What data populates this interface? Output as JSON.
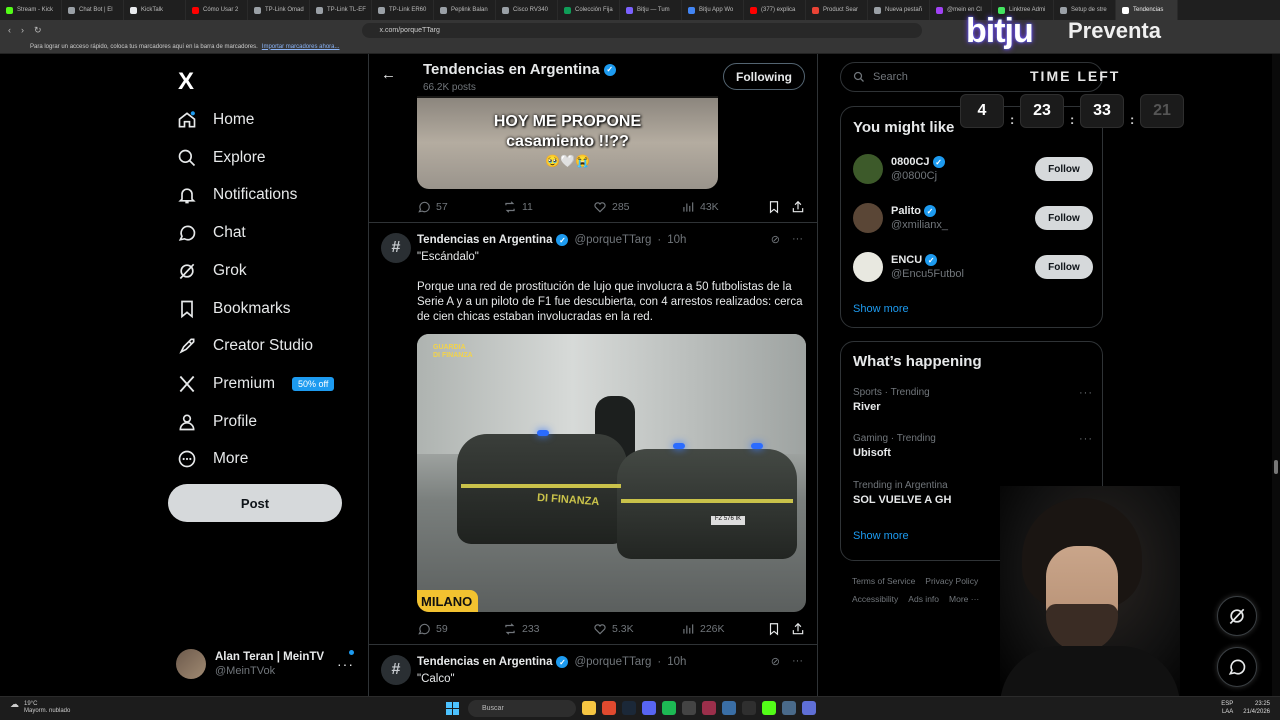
{
  "browser": {
    "tabs": [
      {
        "title": "Stream - Kick",
        "color": "#53fc18"
      },
      {
        "title": "Chat Bot | El",
        "color": "#9aa0a6"
      },
      {
        "title": "KickTalk",
        "color": "#e8eaed"
      },
      {
        "title": "Cómo Usar 2",
        "color": "#ff0000"
      },
      {
        "title": "TP-Link Omad",
        "color": "#9aa0a6"
      },
      {
        "title": "TP-Link TL-EF",
        "color": "#9aa0a6"
      },
      {
        "title": "TP-Link ER60",
        "color": "#9aa0a6"
      },
      {
        "title": "Peplink Balan",
        "color": "#9aa0a6"
      },
      {
        "title": "Cisco RV340",
        "color": "#9aa0a6"
      },
      {
        "title": "Colección Fija",
        "color": "#0f9d58"
      },
      {
        "title": "Bitju — Tum",
        "color": "#7b61ff"
      },
      {
        "title": "Bitju App Wo",
        "color": "#4285f4"
      },
      {
        "title": "(377) explica",
        "color": "#ff0000"
      },
      {
        "title": "Product Sear",
        "color": "#ea4335"
      },
      {
        "title": "Nueva pestañ",
        "color": "#9aa0a6"
      },
      {
        "title": "@mein en Cl",
        "color": "#a142f4"
      },
      {
        "title": "Linktree Admi",
        "color": "#43e660"
      },
      {
        "title": "Setup de stre",
        "color": "#9aa0a6"
      },
      {
        "title": "Tendencias",
        "color": "#ffffff"
      }
    ],
    "url": "x.com/porqueTTarg",
    "bookmarks_hint": "Para lograr un acceso rápido, coloca tus marcadores aquí en la barra de marcadores.",
    "bookmarks_link": "Importar marcadores ahora..."
  },
  "sidebar": {
    "logo": "X",
    "items": [
      {
        "label": "Home",
        "icon": "home-icon"
      },
      {
        "label": "Explore",
        "icon": "search-icon"
      },
      {
        "label": "Notifications",
        "icon": "bell-icon"
      },
      {
        "label": "Chat",
        "icon": "chat-icon"
      },
      {
        "label": "Grok",
        "icon": "grok-icon"
      },
      {
        "label": "Bookmarks",
        "icon": "bookmark-icon"
      },
      {
        "label": "Creator Studio",
        "icon": "rocket-icon"
      },
      {
        "label": "Premium",
        "icon": "x-icon",
        "badge": "50% off"
      },
      {
        "label": "Profile",
        "icon": "person-icon"
      },
      {
        "label": "More",
        "icon": "more-circle-icon"
      }
    ],
    "post_label": "Post",
    "account": {
      "name": "Alan Teran | MeinTV",
      "handle": "@MeinTVok"
    }
  },
  "header": {
    "title": "Tendencias en Argentina",
    "subtitle": "66.2K posts",
    "following_label": "Following"
  },
  "tweet1": {
    "media_caption_line1": "HOY ME PROPONE",
    "media_caption_line2": "casamiento !!??",
    "media_emoji": "🥹🤍😭",
    "replies": "57",
    "reposts": "11",
    "likes": "285",
    "views": "43K"
  },
  "tweet2": {
    "name": "Tendencias en Argentina",
    "handle": "@porqueTTarg",
    "time": "10h",
    "title_line": "\"Escándalo\"",
    "body": "Porque una red de prostitución de lujo que involucra a 50 futbolistas de la Serie A y a un piloto de F1 fue descubierta, con 4 arrestos realizados: cerca de cien chicas estaban involucradas en la red.",
    "media_logo_line1": "GUARDIA",
    "media_logo_line2": "DI FINANZA",
    "media_door_text": "DI FINANZA",
    "media_plate": "FZ 576 IK",
    "media_tag": "MILANO",
    "replies": "59",
    "reposts": "233",
    "likes": "5.3K",
    "views": "226K"
  },
  "tweet3": {
    "name": "Tendencias en Argentina",
    "handle": "@porqueTTarg",
    "time": "10h",
    "title_line": "\"Calco\""
  },
  "right": {
    "search_placeholder": "Search",
    "you_might_like_title": "You might like",
    "suggestions": [
      {
        "name": "0800CJ",
        "handle": "@0800Cj",
        "follow": "Follow",
        "color": "#3d5a2a"
      },
      {
        "name": "Palito",
        "handle": "@xmilianx_",
        "follow": "Follow",
        "color": "#5a4636"
      },
      {
        "name": "ENCU",
        "handle": "@Encu5Futbol",
        "follow": "Follow",
        "color": "#e8e8e0"
      }
    ],
    "show_more": "Show more",
    "whats_happening_title": "What’s happening",
    "trends": [
      {
        "context": "Sports · Trending",
        "title": "River"
      },
      {
        "context": "Gaming · Trending",
        "title": "Ubisoft"
      },
      {
        "context": "Trending in Argentina",
        "title": "SOL VUELVE A GH"
      }
    ],
    "footer": [
      "Terms of Service",
      "Privacy Policy",
      "Accessibility",
      "Ads info",
      "More ···"
    ]
  },
  "overlay": {
    "brand": "bitju",
    "subtitle": "Preventa",
    "time_left_label": "TIME LEFT",
    "countdown": [
      "4",
      "23",
      "33",
      "21"
    ]
  },
  "taskbar": {
    "weather_temp": "19°C",
    "weather_desc": "Mayorm. nublado",
    "search_label": "Buscar",
    "lang": "ESP",
    "lang2": "LAA",
    "time": "23:25",
    "date": "21/4/2026"
  }
}
